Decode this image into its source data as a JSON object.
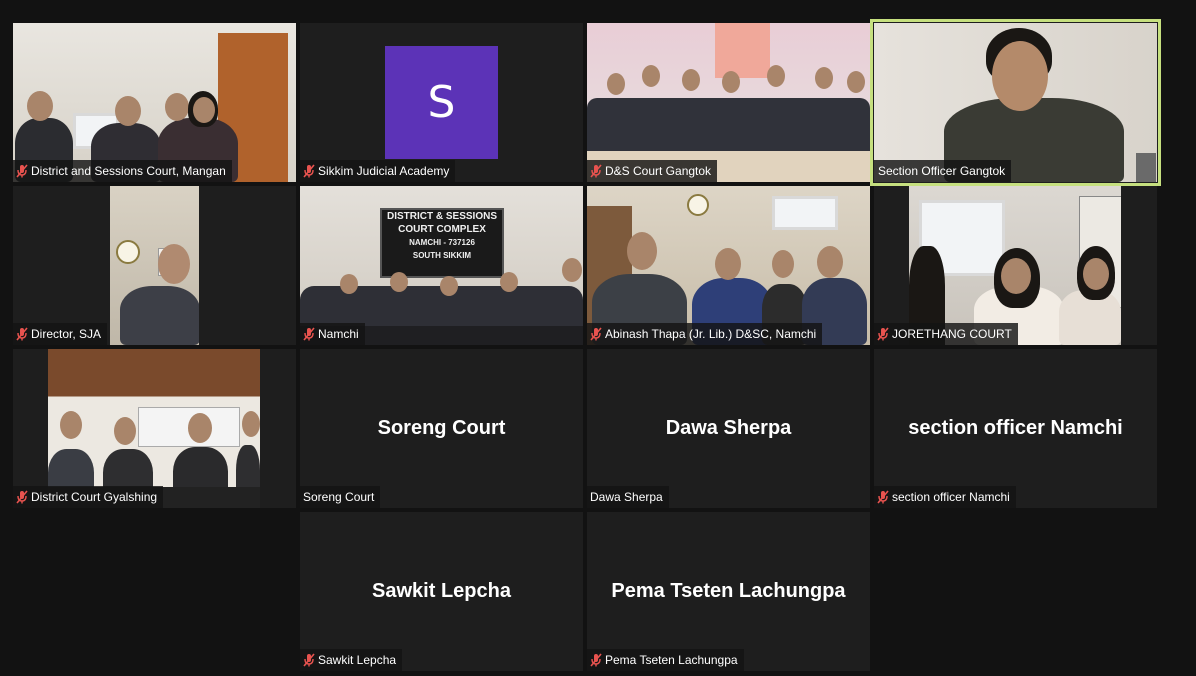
{
  "avatar_color": "#5c33b7",
  "active_speaker_border": "#c6e07f",
  "tiles": [
    {
      "name": "District and Sessions Court, Mangan",
      "muted": true,
      "video": true
    },
    {
      "name": "Sikkim Judicial Academy",
      "muted": true,
      "video": false,
      "avatar_initial": "S"
    },
    {
      "name": "D&S Court Gangtok",
      "muted": true,
      "video": true
    },
    {
      "name": "Section Officer Gangtok",
      "muted": false,
      "video": true,
      "active_speaker": true
    },
    {
      "name": "Director, SJA",
      "muted": true,
      "video": true
    },
    {
      "name": "Namchi",
      "muted": true,
      "video": true,
      "banner_text": [
        "DISTRICT & SESSIONS",
        "COURT COMPLEX",
        "NAMCHI - 737126",
        "SOUTH SIKKIM"
      ]
    },
    {
      "name": "Abinash Thapa (Jr. Lib.) D&SC, Namchi",
      "muted": true,
      "video": true
    },
    {
      "name": "JORETHANG COURT",
      "muted": true,
      "video": true
    },
    {
      "name": "District Court Gyalshing",
      "muted": true,
      "video": true
    },
    {
      "name": "Soreng Court",
      "muted": false,
      "video": false,
      "display_name": "Soreng Court"
    },
    {
      "name": "Dawa Sherpa",
      "muted": false,
      "video": false,
      "display_name": "Dawa Sherpa"
    },
    {
      "name": "section officer Namchi",
      "muted": true,
      "video": false,
      "display_name": "section officer Namchi"
    },
    {
      "name": "Sawkit Lepcha",
      "muted": true,
      "video": false,
      "display_name": "Sawkit Lepcha"
    },
    {
      "name": "Pema Tseten Lachungpa",
      "muted": true,
      "video": false,
      "display_name": "Pema Tseten Lachungpa"
    }
  ]
}
